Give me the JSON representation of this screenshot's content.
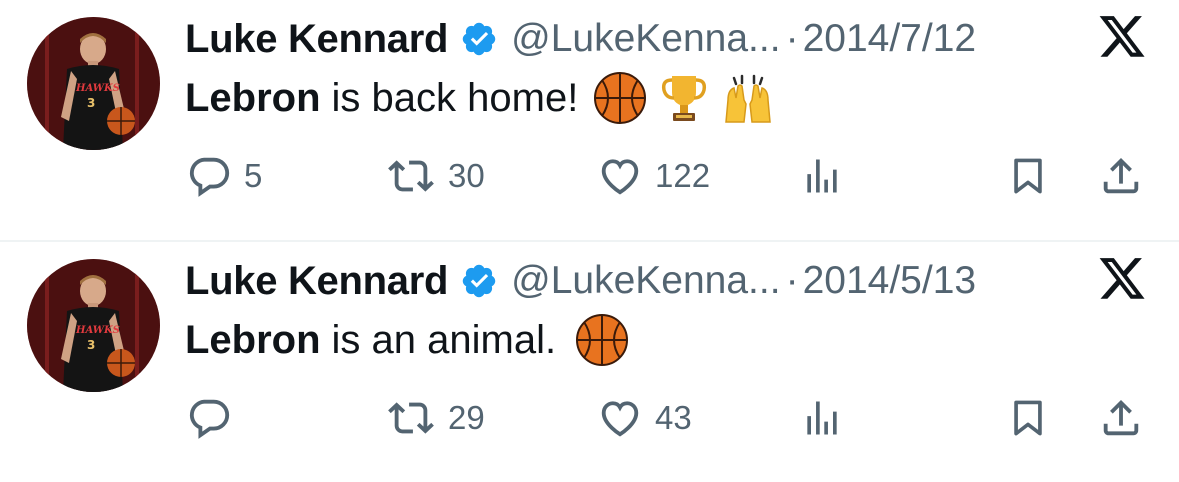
{
  "colors": {
    "text_primary": "#0f1419",
    "text_secondary": "#536471",
    "verified_blue": "#1d9bf0",
    "divider": "#eff3f4"
  },
  "tweets": [
    {
      "author_name": "Luke Kennard",
      "handle": "@LukeKenna...",
      "separator": "·",
      "date": "2014/7/12",
      "text_bold": "Lebron",
      "text_rest": "is back home!",
      "emojis": [
        "basketball-emoji",
        "trophy-emoji",
        "raising-hands-emoji"
      ],
      "reply_count": "5",
      "retweet_count": "30",
      "like_count": "122"
    },
    {
      "author_name": "Luke Kennard",
      "handle": "@LukeKenna...",
      "separator": "·",
      "date": "2014/5/13",
      "text_bold": "Lebron",
      "text_rest": "is an animal.",
      "emojis": [
        "basketball-emoji"
      ],
      "reply_count": "",
      "retweet_count": "29",
      "like_count": "43"
    }
  ],
  "icons": {
    "verified": "verified-badge-icon",
    "platform": "x-logo-icon",
    "reply": "reply-icon",
    "retweet": "retweet-icon",
    "like": "heart-icon",
    "views": "views-icon",
    "bookmark": "bookmark-icon",
    "share": "share-icon"
  }
}
